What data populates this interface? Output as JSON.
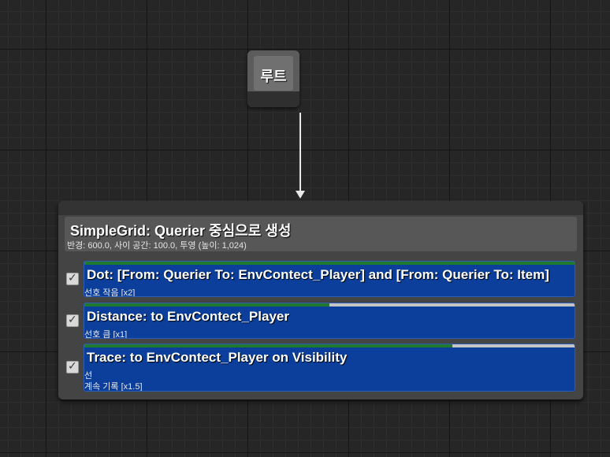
{
  "root_node": {
    "label": "루트"
  },
  "main_node": {
    "title": "SimpleGrid: Querier 중심으로 생성",
    "subtitle": "반경: 600.0, 사이 공간: 100.0, 투영 (높이: 1,024)"
  },
  "tests": [
    {
      "checked": true,
      "title": "Dot: [From: Querier To: EnvContect_Player] and [From: Querier To: Item]",
      "lines": [
        "선호 작음 [x2]"
      ],
      "score_fraction": 1.0
    },
    {
      "checked": true,
      "title": "Distance: to EnvContect_Player",
      "lines": [
        "선호 큼 [x1]"
      ],
      "score_fraction": 0.5
    },
    {
      "checked": true,
      "title": "Trace: to EnvContect_Player on Visibility",
      "lines": [
        "선",
        "계속 기록 [x1.5]"
      ],
      "score_fraction": 0.75
    }
  ],
  "icons": {
    "checkbox": "checkmark-icon",
    "wire_end": "arrow-down-icon"
  },
  "colors": {
    "test_background": "#0c3f9b",
    "score_fill": "#1f7a2e",
    "score_track": "#c4c4c4",
    "node_background": "#444444"
  }
}
